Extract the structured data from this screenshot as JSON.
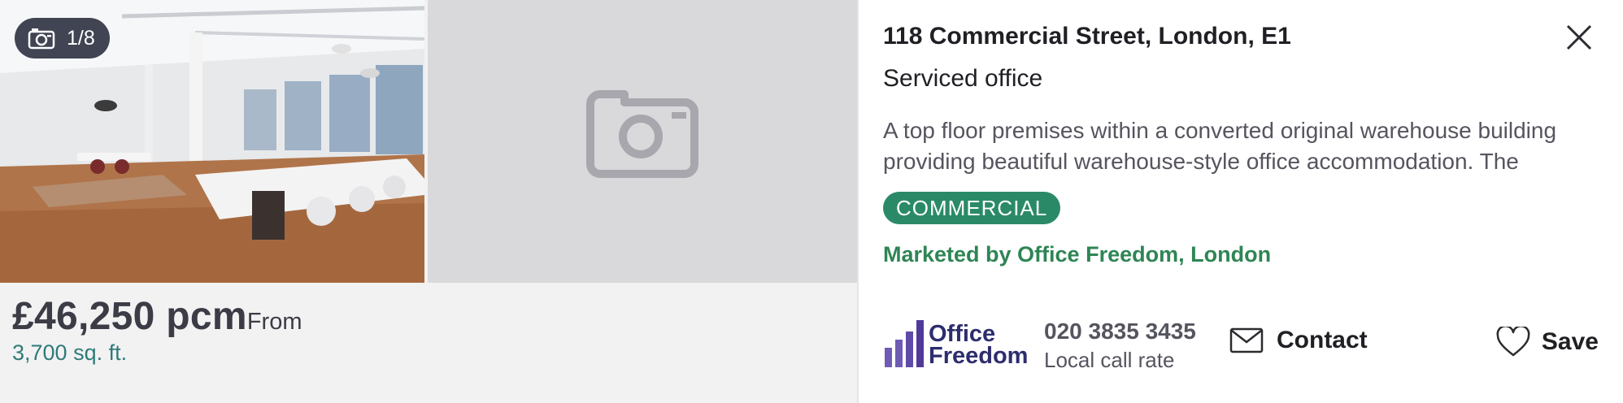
{
  "gallery": {
    "counter": "1/8",
    "icons": {
      "counter": "camera-icon",
      "placeholder": "camera-placeholder-icon"
    }
  },
  "listing": {
    "price": "£46,250 pcm",
    "price_suffix": "From",
    "size": "3,700 sq. ft.",
    "address": "118 Commercial Street, London, E1",
    "type": "Serviced office",
    "description": "A top floor premises within a converted original warehouse building providing beautiful warehouse-style office accommodation. The",
    "badge": "COMMERCIAL",
    "marketed_by": "Marketed by Office Freedom, London"
  },
  "agent": {
    "logo_line1": "Office",
    "logo_line2": "Freedom",
    "phone": "020 3835 3435",
    "phone_note": "Local call rate"
  },
  "actions": {
    "contact_label": "Contact",
    "save_label": "Save"
  },
  "colors": {
    "accent_green": "#2e8554",
    "badge_bg": "#2a8a68",
    "size_teal": "#2e7b78",
    "logo_navy": "#2d2d6e",
    "logo_purple": "#6f5bb5"
  }
}
